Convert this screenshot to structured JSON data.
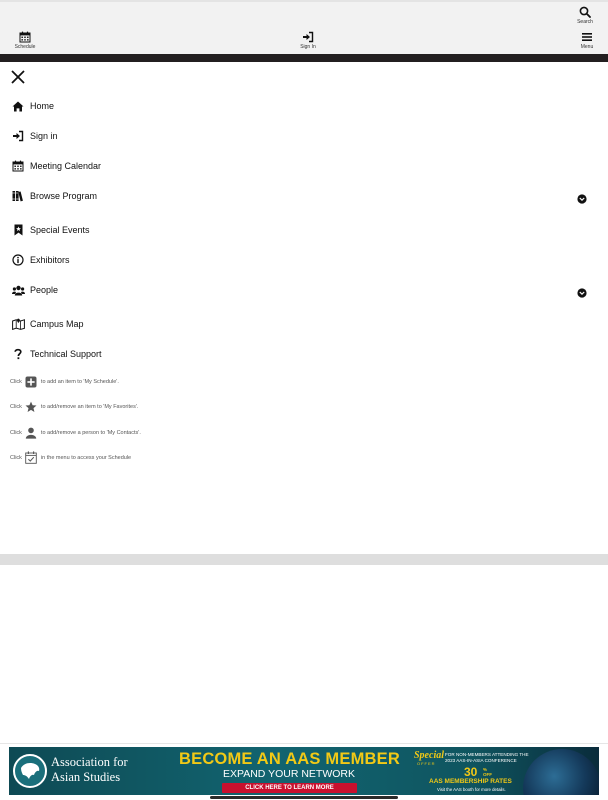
{
  "toolbar": {
    "search_label": "Search",
    "schedule_label": "Schedule",
    "signin_label": "Sign In",
    "menu_label": "Menu"
  },
  "menu": {
    "close_icon": "close-icon",
    "items": [
      {
        "label": "Home",
        "icon": "home-icon"
      },
      {
        "label": "Sign in",
        "icon": "sign-in-icon"
      },
      {
        "label": "Meeting Calendar",
        "icon": "calendar-icon"
      },
      {
        "label": "Browse Program",
        "icon": "books-icon",
        "expandable": true
      },
      {
        "label": "Special Events",
        "icon": "bookmark-star-icon"
      },
      {
        "label": "Exhibitors",
        "icon": "info-icon"
      },
      {
        "label": "People",
        "icon": "people-icon",
        "expandable": true
      },
      {
        "label": "Campus Map",
        "icon": "map-icon"
      },
      {
        "label": "Technical Support",
        "icon": "question-icon"
      }
    ]
  },
  "hints": [
    {
      "prefix": "Click",
      "icon": "plus-square-icon",
      "text": "to add an item to 'My Schedule'."
    },
    {
      "prefix": "Click",
      "icon": "star-icon",
      "text": "to add/remove an item to 'My Favorites'."
    },
    {
      "prefix": "Click",
      "icon": "user-icon",
      "text": "to add/remove a person to 'My Contacts'."
    },
    {
      "prefix": "Click",
      "icon": "calendar-check-icon",
      "text": "in the menu to access your Schedule"
    }
  ],
  "ad": {
    "org_line1": "Association for",
    "org_line2": "Asian Studies",
    "headline": "BECOME AN AAS MEMBER",
    "subline": "EXPAND YOUR NETWORK",
    "cta": "CLICK HERE TO LEARN MORE",
    "special": "Special",
    "offer": "OFFER",
    "fine_line1": "FOR NON-MEMBERS ATTENDING THE",
    "fine_line2": "2023 AAS-IN-ASIA CONFERENCE",
    "discount": "30",
    "discount_unit": "%",
    "discount_off": "OFF",
    "rates": "AAS MEMBERSHIP RATES",
    "visit": "Visit the AAS booth for more details.",
    "colors": {
      "teal": "#126470",
      "gold": "#f2c916",
      "cta_red": "#c8102e"
    }
  }
}
